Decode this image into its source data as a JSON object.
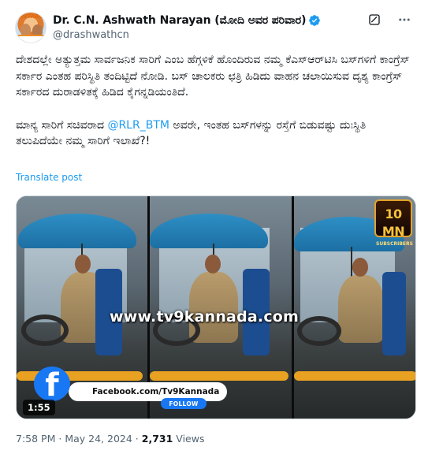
{
  "author": {
    "display_name": "Dr. C.N. Ashwath Narayan (ಮೋದಿ ಅವರ ಪರಿವಾರ)",
    "handle": "@drashwathcn",
    "avatar_tag": "AVTARO"
  },
  "post": {
    "paragraph_1": "ದೇಶದಲ್ಲೇ ಅತ್ಯುತ್ತಮ ಸಾರ್ವಜನಿಕ ಸಾರಿಗೆ ಎಂಬ ಹೆಗ್ಗಳಿಕೆ ಹೊಂದಿರುವ ನಮ್ಮ ಕೆಎಸ್ಆರ್‌ಟಿಸಿ ಬಸ್‌ಗಳಿಗೆ ಕಾಂಗ್ರೆಸ್ ಸರ್ಕಾರ ಎಂತಹ ಪರಿಸ್ಥಿತಿ ತಂದಿಟ್ಟಿದೆ ನೋಡಿ. ಬಸ್ ಚಾಲಕರು ಛತ್ರಿ ಹಿಡಿದು ವಾಹನ ಚಲಾಯಿಸುವ ದೃಶ್ಯ ಕಾಂಗ್ರೆಸ್ ಸರ್ಕಾರದ ದುರಾಡಳಿತಕ್ಕೆ ಹಿಡಿದ ಕೈಗನ್ನಡಿಯಂತಿದೆ.",
    "paragraph_2_before": "ಮಾನ್ಯ ಸಾರಿಗೆ ಸಚಿವರಾದ ",
    "paragraph_2_mention": "@RLR_BTM",
    "paragraph_2_after": " ಅವರೇ, ಇಂತಹ ಬಸ್‌ಗಳನ್ನು ರಸ್ತೆಗೆ ಬಿಡುವಷ್ಟು ದುಃಸ್ಥಿತಿ ತಲುಪಿದೆಯೇ ನಮ್ಮ ಸಾರಿಗೆ ಇಲಾಖೆ?!",
    "translate_label": "Translate post"
  },
  "video": {
    "watermark": "www.tv9kannada.com",
    "badge_big": "10 MN",
    "badge_small": "SUBSCRIBERS",
    "facebook_letter": "f",
    "facebook_text": "Facebook.com/Tv9Kannada",
    "follow_label": "FOLLOW",
    "duration": "1:55"
  },
  "meta": {
    "time": "7:58 PM",
    "separator": "·",
    "date": "May 24, 2024",
    "views_count": "2,731",
    "views_label": "Views"
  },
  "colors": {
    "accent": "#1d9bf0",
    "text": "#0f1419",
    "secondary": "#536471",
    "facebook": "#1877f2"
  },
  "icons": {
    "verified": "verified-badge-icon",
    "grok": "grok-icon",
    "more": "more-options-icon"
  }
}
